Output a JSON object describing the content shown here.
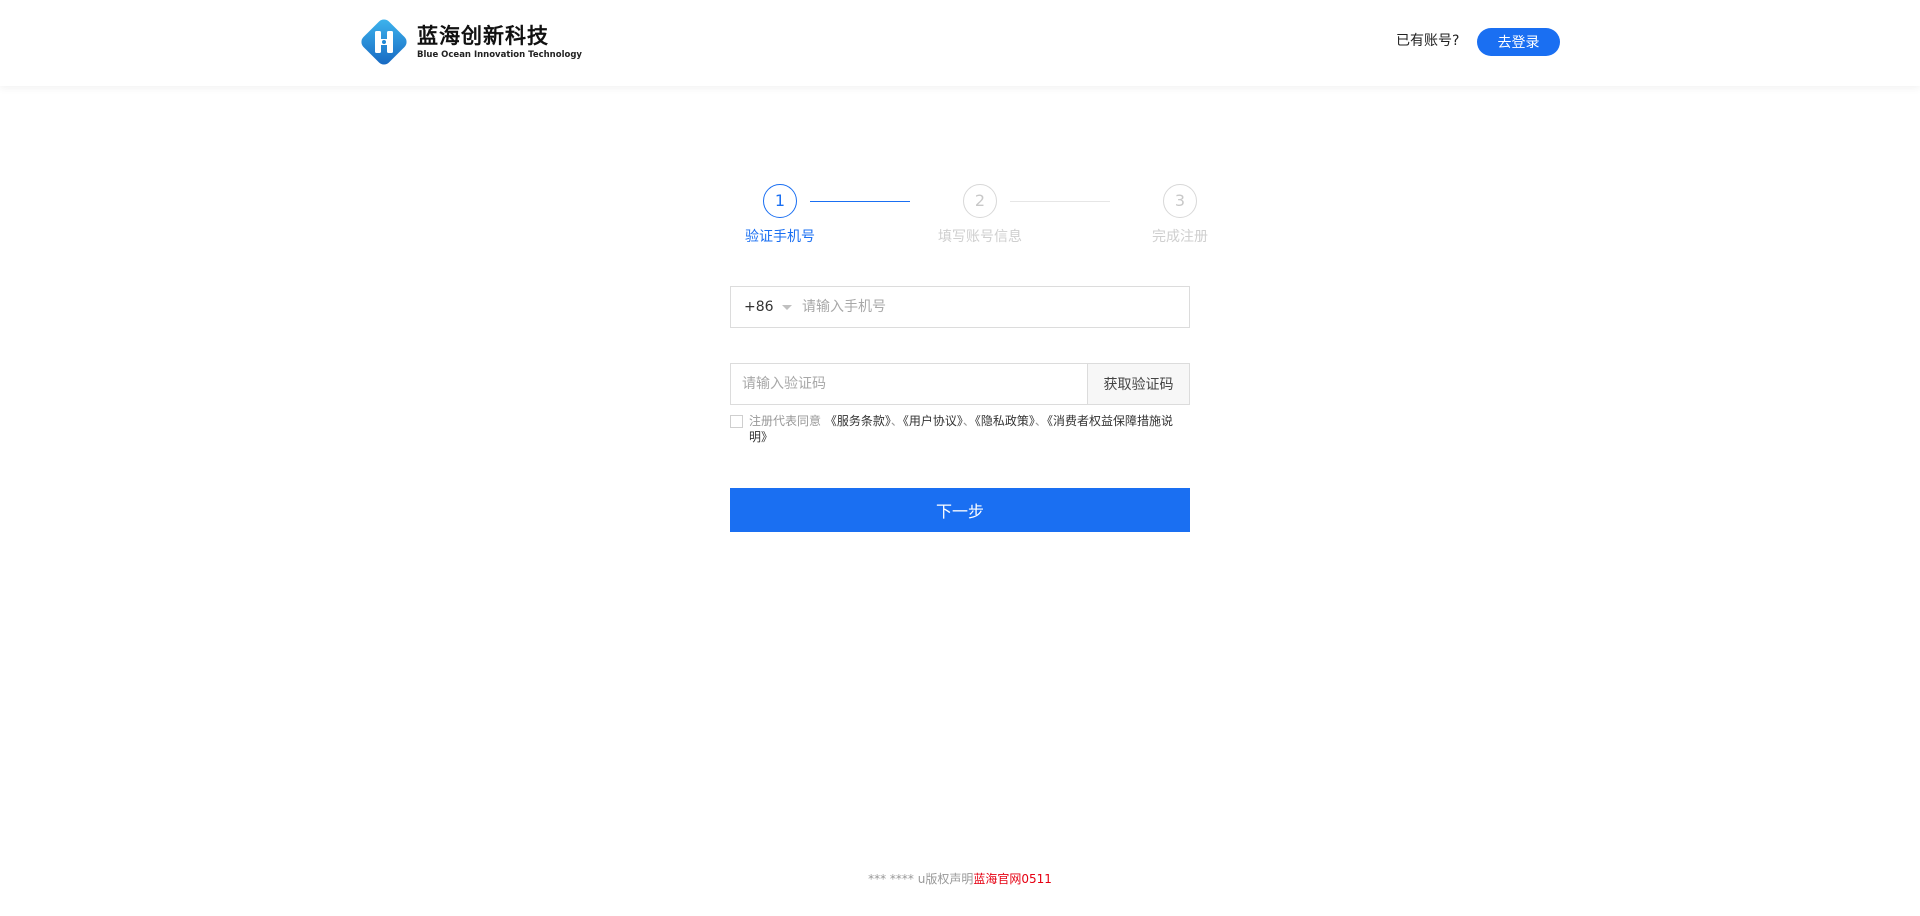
{
  "header": {
    "logo_cn": "蓝海创新科技",
    "logo_en": "Blue Ocean Innovation Technology",
    "has_account": "已有账号?",
    "login_button": "去登录"
  },
  "steps": [
    {
      "number": "1",
      "label": "验证手机号",
      "state": "active"
    },
    {
      "number": "2",
      "label": "填写账号信息",
      "state": "inactive"
    },
    {
      "number": "3",
      "label": "完成注册",
      "state": "inactive"
    }
  ],
  "form": {
    "country_code": "+86",
    "phone_placeholder": "请输入手机号",
    "code_placeholder": "请输入验证码",
    "get_code_button": "获取验证码",
    "agree_prefix": "注册代表同意",
    "agreements": [
      "《服务条款》",
      "《用户协议》",
      "《隐私政策》",
      "《消费者权益保障措施说明》"
    ],
    "separator": "、",
    "agree_checked": false,
    "next_button": "下一步"
  },
  "footer": {
    "text": "*** **** u版权声明",
    "link": "蓝海官网0511"
  },
  "colors": {
    "primary": "#1a6ff2",
    "footer_link": "#e60012",
    "inactive": "#cfcfcf"
  }
}
